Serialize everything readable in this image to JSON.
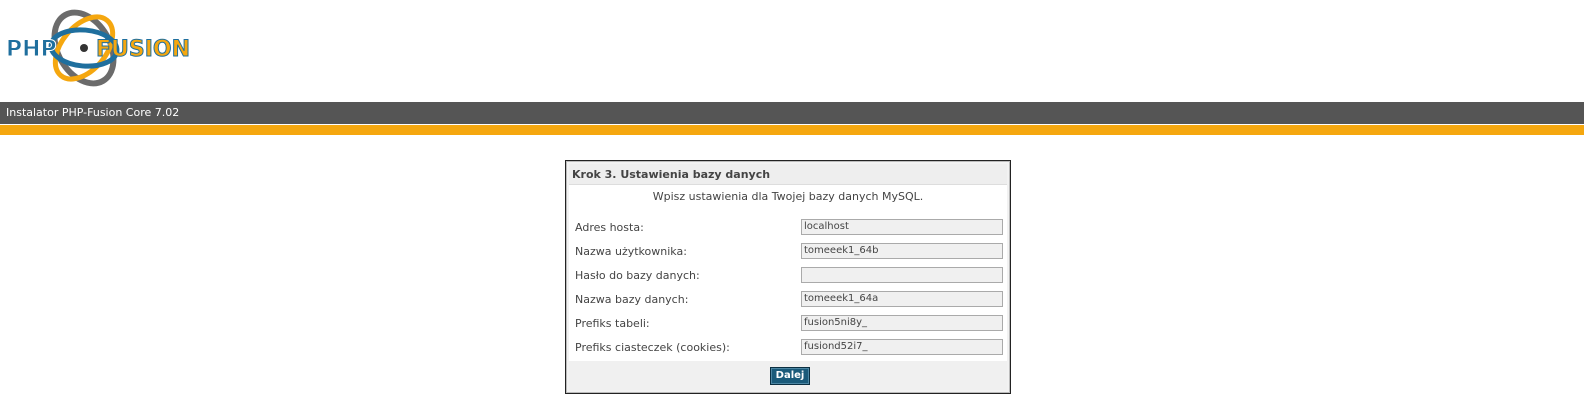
{
  "header": {
    "logo_text_left": "PHP",
    "logo_text_right": "FUSION",
    "logo_colors": {
      "blue": "#1f6f9e",
      "orange": "#f5a70f",
      "gray": "#6b6b6b"
    }
  },
  "titlebar": {
    "text": "Instalator PHP-Fusion Core 7.02"
  },
  "panel": {
    "title": "Krok 3. Ustawienia bazy danych",
    "intro": "Wpisz ustawienia dla Twojej bazy danych MySQL.",
    "fields": [
      {
        "label": "Adres hosta:",
        "value": "localhost"
      },
      {
        "label": "Nazwa użytkownika:",
        "value": "tomeeek1_64b"
      },
      {
        "label": "Hasło do bazy danych:",
        "value": ""
      },
      {
        "label": "Nazwa bazy danych:",
        "value": "tomeeek1_64a"
      },
      {
        "label": "Prefiks tabeli:",
        "value": "fusion5ni8y_"
      },
      {
        "label": "Prefiks ciasteczek (cookies):",
        "value": "fusiond52i7_"
      }
    ],
    "next_label": "Dalej"
  },
  "colors": {
    "titlebar": "#555555",
    "accent": "#f5a70f",
    "button": "#1a5a7a"
  }
}
